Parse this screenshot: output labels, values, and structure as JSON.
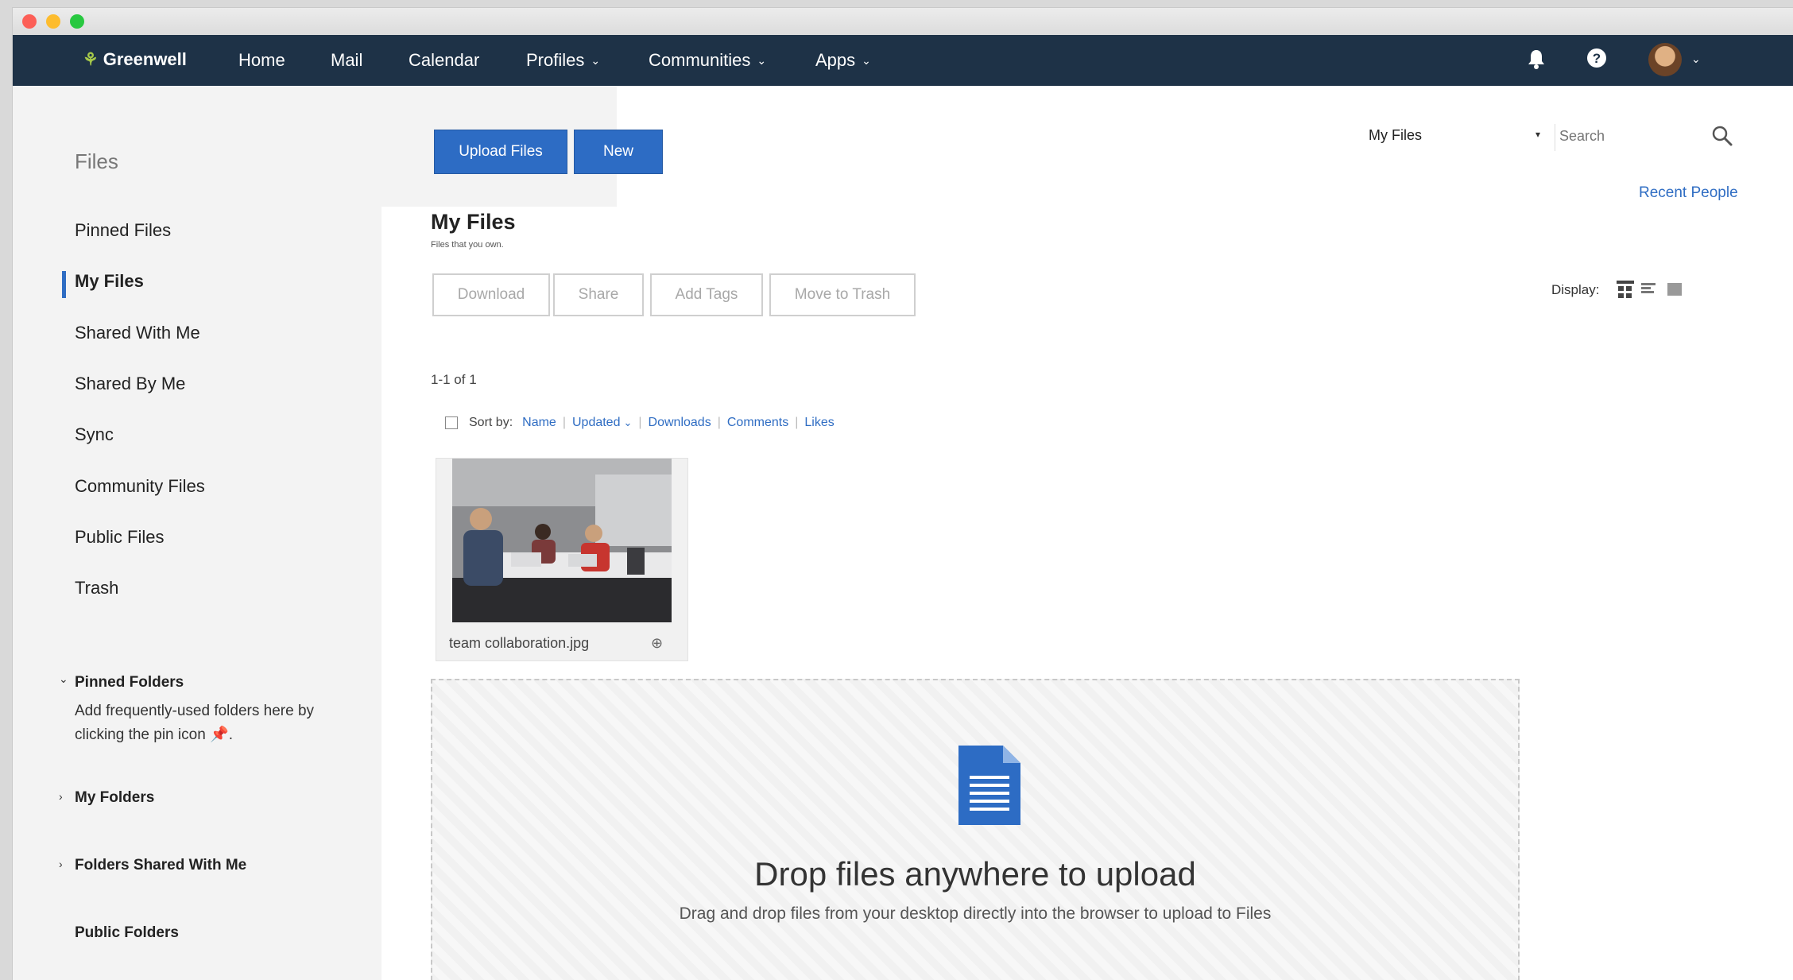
{
  "nav": {
    "brand": "Greenwell",
    "items": [
      {
        "label": "Home",
        "chevron": false
      },
      {
        "label": "Mail",
        "chevron": false
      },
      {
        "label": "Calendar",
        "chevron": false
      },
      {
        "label": "Profiles",
        "chevron": true
      },
      {
        "label": "Communities",
        "chevron": true
      },
      {
        "label": "Apps",
        "chevron": true
      }
    ],
    "icons": [
      "bell-icon",
      "help-icon"
    ]
  },
  "sidebar": {
    "title": "Files",
    "items": [
      {
        "label": "Pinned Files"
      },
      {
        "label": "My Files",
        "active": true
      },
      {
        "label": "Shared With Me"
      },
      {
        "label": "Shared By Me"
      },
      {
        "label": "Sync"
      },
      {
        "label": "Community Files"
      },
      {
        "label": "Public Files"
      },
      {
        "label": "Trash"
      }
    ],
    "pinned_folders": {
      "label": "Pinned Folders",
      "note_line1": "Add frequently-used folders here by",
      "note_line2": "clicking the pin icon",
      "note_end": "."
    },
    "my_folders": "My Folders",
    "folders_shared": "Folders Shared With Me",
    "public_folders": "Public Folders"
  },
  "toolbar": {
    "upload_label": "Upload Files",
    "new_label": "New"
  },
  "search": {
    "scope": "My Files",
    "placeholder": "Search"
  },
  "recent_people": "Recent People",
  "main": {
    "title": "My Files",
    "subtitle": "Files that you own.",
    "actions": [
      "Download",
      "Share",
      "Add Tags",
      "Move to Trash"
    ],
    "display_label": "Display:",
    "count": "1-1 of 1",
    "sort_label": "Sort by:",
    "sort_options": [
      "Name",
      "Updated",
      "Downloads",
      "Comments",
      "Likes"
    ],
    "files": [
      {
        "name": "team collaboration.jpg"
      }
    ]
  },
  "dropzone": {
    "title": "Drop files anywhere to upload",
    "subtitle": "Drag and drop files from your desktop directly into the browser to upload to Files"
  },
  "colors": {
    "nav_bg": "#1e3247",
    "accent": "#2d6cc4",
    "sidebar_bg": "#f3f3f3"
  }
}
